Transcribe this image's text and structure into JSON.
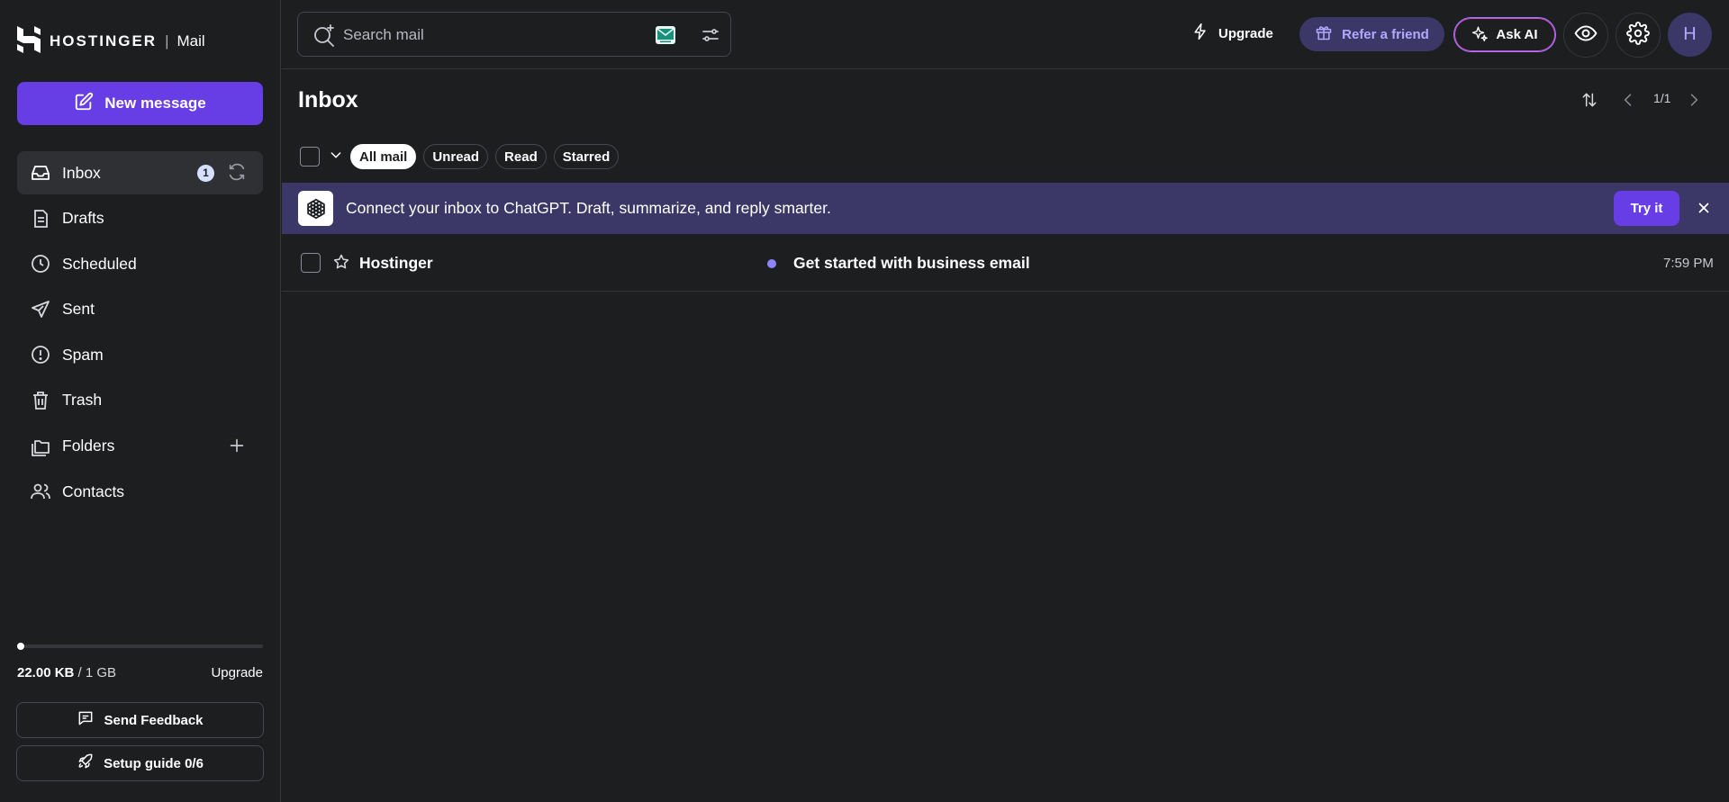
{
  "brand": {
    "name": "HOSTINGER",
    "app": "Mail"
  },
  "sidebar": {
    "new_message": "New message",
    "items": [
      {
        "label": "Inbox",
        "badge": "1",
        "icon": "inbox-icon"
      },
      {
        "label": "Drafts",
        "icon": "drafts-icon"
      },
      {
        "label": "Scheduled",
        "icon": "clock-icon"
      },
      {
        "label": "Sent",
        "icon": "send-icon"
      },
      {
        "label": "Spam",
        "icon": "spam-icon"
      },
      {
        "label": "Trash",
        "icon": "trash-icon"
      },
      {
        "label": "Folders",
        "icon": "folders-icon"
      },
      {
        "label": "Contacts",
        "icon": "contacts-icon"
      }
    ],
    "storage": {
      "used": "22.00 KB",
      "total": "/ 1 GB",
      "upgrade": "Upgrade",
      "fill_fraction": 0.0
    },
    "send_feedback": "Send Feedback",
    "setup_guide": "Setup guide 0/6"
  },
  "topbar": {
    "search_placeholder": "Search mail",
    "upgrade": "Upgrade",
    "refer": "Refer a friend",
    "ask_ai": "Ask AI",
    "avatar_initial": "H"
  },
  "main": {
    "title": "Inbox",
    "pager": "1/1",
    "filters": [
      "All mail",
      "Unread",
      "Read",
      "Starred"
    ],
    "active_filter": "All mail",
    "banner": {
      "text": "Connect your inbox to ChatGPT. Draft, summarize, and reply smarter.",
      "button": "Try it"
    },
    "emails": [
      {
        "sender": "Hostinger",
        "subject": "Get started with business email",
        "time": "7:59 PM",
        "unread": true
      }
    ]
  },
  "colors": {
    "accent": "#673de6",
    "background": "#1d1e20",
    "banner": "#3b3766",
    "unread_dot": "#8c85ff"
  }
}
